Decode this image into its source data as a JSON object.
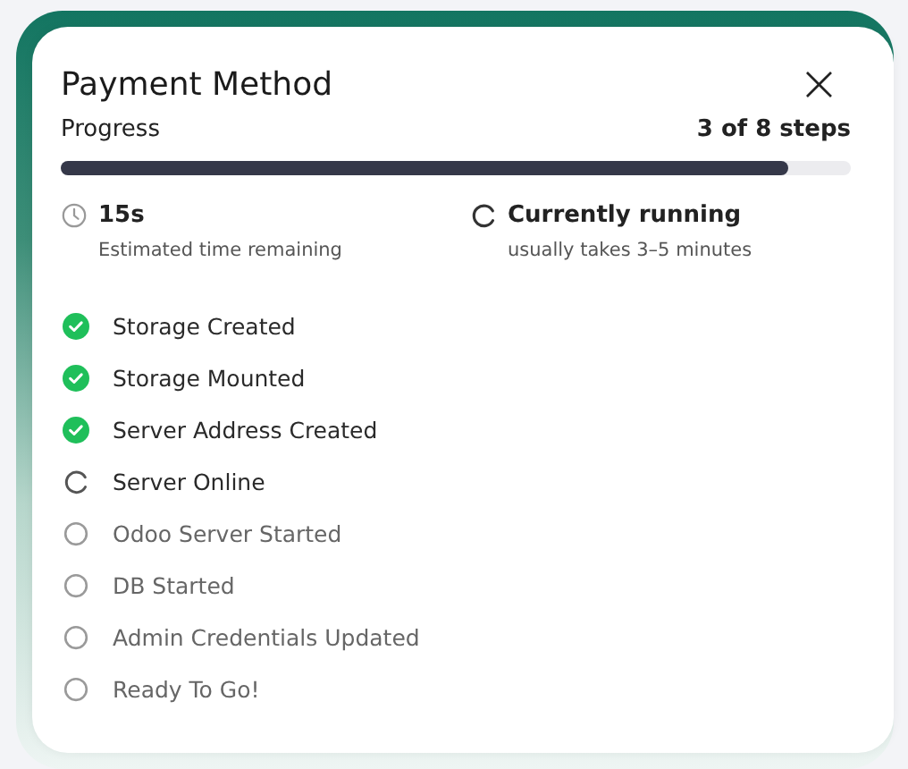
{
  "dialog": {
    "title": "Payment Method",
    "close": "×"
  },
  "progress": {
    "label": "Progress",
    "count": "3 of 8 steps",
    "level": 0.92
  },
  "info": [
    {
      "kind": "time",
      "value": "15s",
      "caption": "Estimated time remaining"
    },
    {
      "kind": "running",
      "value": "Currently running",
      "caption": "usually takes 3–5 minutes"
    }
  ],
  "steps": [
    {
      "label": "Storage Created",
      "kind": "done"
    },
    {
      "label": "Storage Mounted",
      "kind": "done"
    },
    {
      "label": "Server Address Created",
      "kind": "done"
    },
    {
      "label": "Server Online",
      "kind": "running"
    },
    {
      "label": "Odoo Server Started",
      "kind": "pending"
    },
    {
      "label": "DB Started",
      "kind": "pending"
    },
    {
      "label": "Admin Credentials Updated",
      "kind": "pending"
    },
    {
      "label": "Ready To Go!",
      "kind": "pending"
    }
  ]
}
